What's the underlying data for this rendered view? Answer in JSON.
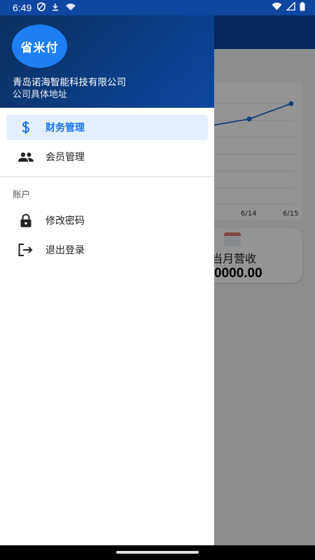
{
  "status_bar": {
    "time": "6:49",
    "left_icons": [
      "shield-icon",
      "download-icon",
      "wifi-icon"
    ],
    "right_icons": [
      "wifi-icon",
      "signal-icon",
      "battery-icon"
    ]
  },
  "drawer": {
    "logo_text": "省米付",
    "company_name": "青岛诺海智能科技有限公司",
    "company_address": "公司具体地址",
    "primary_items": [
      {
        "label": "财务管理",
        "icon": "dollar-icon",
        "active": true
      },
      {
        "label": "会员管理",
        "icon": "people-icon",
        "active": false
      }
    ],
    "section_label": "账户",
    "account_items": [
      {
        "label": "修改密码",
        "icon": "lock-icon"
      },
      {
        "label": "退出登录",
        "icon": "logout-icon"
      }
    ]
  },
  "background": {
    "chart_ticks": [
      "6/14",
      "6/15"
    ],
    "stat_title": "当月营收",
    "stat_value": "0000.00"
  },
  "colors": {
    "header": "#0d47a1",
    "active_text": "#1a73e8",
    "active_bg": "#e3effd"
  }
}
